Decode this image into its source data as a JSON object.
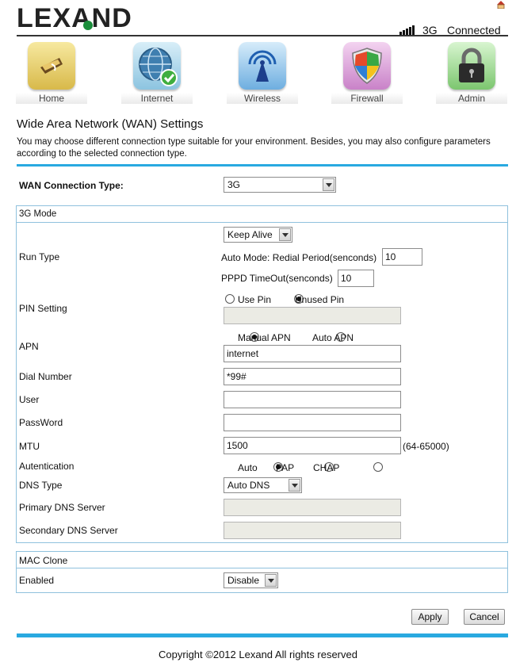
{
  "header": {
    "logo": "LEXAND",
    "network": "3G",
    "status": "Connected"
  },
  "nav": [
    {
      "label": "Home",
      "icon": "home-icon"
    },
    {
      "label": "Internet",
      "icon": "globe-icon"
    },
    {
      "label": "Wireless",
      "icon": "wireless-icon"
    },
    {
      "label": "Firewall",
      "icon": "firewall-shield-icon"
    },
    {
      "label": "Admin",
      "icon": "padlock-icon"
    }
  ],
  "page": {
    "title": "Wide Area Network (WAN) Settings",
    "description": "You may choose different connection type suitable for your environment. Besides, you may also configure parameters according to the selected connection type."
  },
  "wan": {
    "label": "WAN Connection Type:",
    "value": "3G"
  },
  "mode3g": {
    "section_title": "3G Mode",
    "run_type_label": "Run Type",
    "run_type_value": "Keep Alive",
    "redial_label": "Auto Mode: Redial Period(senconds)",
    "redial_value": "10",
    "pppd_label": "PPPD TimeOut(senconds)",
    "pppd_value": "10",
    "pin_label": "PIN Setting",
    "pin_use": "Use Pin",
    "pin_unused": "Unused Pin",
    "pin_value": "",
    "apn_label": "APN",
    "apn_manual": "Manual APN",
    "apn_auto": "Auto APN",
    "apn_value": "internet",
    "dial_label": "Dial Number",
    "dial_value": "*99#",
    "user_label": "User",
    "user_value": "",
    "password_label": "PassWord",
    "password_value": "",
    "mtu_label": "MTU",
    "mtu_value": "1500",
    "mtu_hint": "(64-65000)",
    "auth_label": "Autentication",
    "auth_auto": "Auto",
    "auth_pap": "PAP",
    "auth_chap": "CHAP",
    "dns_type_label": "DNS Type",
    "dns_type_value": "Auto DNS",
    "primary_dns_label": "Primary DNS Server",
    "primary_dns_value": "",
    "secondary_dns_label": "Secondary DNS Server",
    "secondary_dns_value": ""
  },
  "mac": {
    "section_title": "MAC Clone",
    "enabled_label": "Enabled",
    "enabled_value": "Disable"
  },
  "buttons": {
    "apply": "Apply",
    "cancel": "Cancel"
  },
  "footer": {
    "copyright": "Copyright ©2012 Lexand All rights reserved"
  },
  "colors": {
    "accent": "#29a9e0",
    "box_border": "#8fc1dd",
    "logo_dot": "#1b8e3b"
  }
}
